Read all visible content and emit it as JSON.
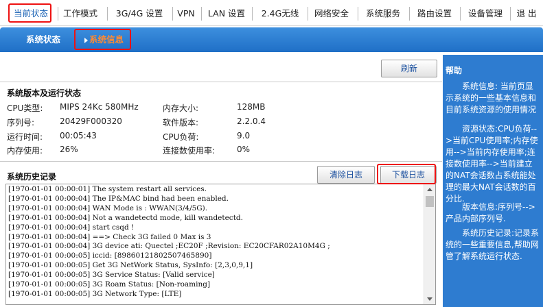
{
  "top_nav": [
    {
      "label": "当前状态",
      "active": true
    },
    {
      "label": "工作模式"
    },
    {
      "label": "3G/4G 设置"
    },
    {
      "label": "VPN"
    },
    {
      "label": "LAN 设置"
    },
    {
      "label": "2.4G无线"
    },
    {
      "label": "网络安全"
    },
    {
      "label": "系统服务"
    },
    {
      "label": "路由设置"
    },
    {
      "label": "设备管理"
    },
    {
      "label": "退 出"
    }
  ],
  "sub_nav": [
    {
      "label": "系统状态"
    },
    {
      "label": "系统信息",
      "active": true
    }
  ],
  "refresh_label": "刷新",
  "sysinfo": {
    "title": "系统版本及运行状态",
    "rows": [
      {
        "label": "CPU类型:",
        "value": "MIPS 24Kc 580MHz"
      },
      {
        "label": "内存大小:",
        "value": "128MB"
      },
      {
        "label": "序列号:",
        "value": "20429F000320"
      },
      {
        "label": "软件版本:",
        "value": "2.2.0.4"
      },
      {
        "label": "运行时间:",
        "value": "00:05:43"
      },
      {
        "label": "CPU负荷:",
        "value": "9.0"
      },
      {
        "label": "内存使用:",
        "value": "26%"
      },
      {
        "label": "连接数使用率:",
        "value": "0%"
      }
    ]
  },
  "history": {
    "title": "系统历史记录",
    "clear_label": "清除日志",
    "download_label": "下载日志",
    "lines": [
      "[1970-01-01 00:00:01] The system restart all services.",
      "[1970-01-01 00:00:04] The IP&MAC bind had been enabled.",
      "[1970-01-01 00:00:04] WAN Mode is : WWAN(3/4/5G).",
      "[1970-01-01 00:00:04] Not a wandetectd mode, kill wandetectd.",
      "[1970-01-01 00:00:04] start csqd !",
      "[1970-01-01 00:00:04] ==> Check 3G failed 0 Max is 3",
      "[1970-01-01 00:00:04] 3G device ati: Quectel ;EC20F ;Revision: EC20CFAR02A10M4G ;",
      "[1970-01-01 00:00:05] iccid: [89860121802507465890]",
      "[1970-01-01 00:00:05] Get 3G NetWork Status, SysInfo: [2,3,0,9,1]",
      "[1970-01-01 00:00:05] 3G Service Status: [Valid service]",
      "[1970-01-01 00:00:05] 3G Roam Status: [Non-roaming]",
      "[1970-01-01 00:00:05] 3G Network Type: [LTE]"
    ]
  },
  "help": {
    "title": "帮助",
    "paragraphs": [
      "系统信息: 当前页显示系统的一些基本信息和目前系统资源的使用情况",
      "资源状态:CPU负荷-->当前CPU使用率;内存使用-->当前内存使用率;连接数使用率-->当前建立的NAT会话数占系统能处理的最大NAT会话数的百分比.",
      "版本信息:序列号-->产品内部序列号.",
      "系统历史记录:记录系统的一些重要信息,帮助网管了解系统运行状态."
    ]
  },
  "colors": {
    "accent_blue": "#2e7cd0",
    "active_orange": "#ff8a33",
    "highlight_red": "#ee1111"
  }
}
